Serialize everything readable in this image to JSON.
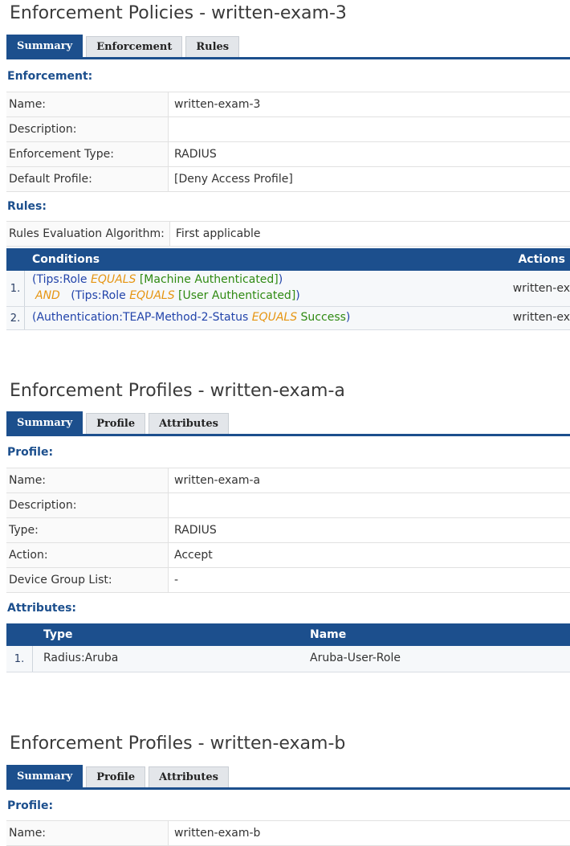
{
  "policy": {
    "title": "Enforcement Policies - written-exam-3",
    "tabs": [
      "Summary",
      "Enforcement",
      "Rules"
    ],
    "section_enforcement": "Enforcement:",
    "fields": [
      {
        "label": "Name:",
        "value": "written-exam-3"
      },
      {
        "label": "Description:",
        "value": ""
      },
      {
        "label": "Enforcement Type:",
        "value": "RADIUS"
      },
      {
        "label": "Default Profile:",
        "value": "[Deny Access Profile]"
      }
    ],
    "section_rules": "Rules:",
    "algorithm_label": "Rules Evaluation Algorithm:",
    "algorithm_value": "First applicable",
    "rules_headers": {
      "conditions": "Conditions",
      "actions": "Actions"
    },
    "rules": [
      {
        "num": "1.",
        "line1": {
          "open": "(",
          "attr": "Tips:Role",
          "op": "EQUALS",
          "val": "[Machine Authenticated]",
          "close": ")"
        },
        "line2": {
          "join": "AND",
          "open": "(",
          "attr": "Tips:Role",
          "op": "EQUALS",
          "val": "[User Authenticated]",
          "close": ")"
        },
        "action": "written-ex"
      },
      {
        "num": "2.",
        "line1": {
          "open": "(",
          "attr": "Authentication:TEAP-Method-2-Status",
          "op": "EQUALS",
          "val": "Success",
          "close": ")"
        },
        "action": "written-ex"
      }
    ]
  },
  "profile_a": {
    "title": "Enforcement Profiles - written-exam-a",
    "tabs": [
      "Summary",
      "Profile",
      "Attributes"
    ],
    "section_profile": "Profile:",
    "fields": [
      {
        "label": "Name:",
        "value": "written-exam-a"
      },
      {
        "label": "Description:",
        "value": ""
      },
      {
        "label": "Type:",
        "value": "RADIUS"
      },
      {
        "label": "Action:",
        "value": "Accept"
      },
      {
        "label": "Device Group List:",
        "value": "-"
      }
    ],
    "section_attributes": "Attributes:",
    "attr_headers": {
      "type": "Type",
      "name": "Name"
    },
    "attributes": [
      {
        "num": "1.",
        "type": "Radius:Aruba",
        "name": "Aruba-User-Role"
      }
    ]
  },
  "profile_b": {
    "title": "Enforcement Profiles - written-exam-b",
    "tabs": [
      "Summary",
      "Profile",
      "Attributes"
    ],
    "section_profile": "Profile:",
    "fields": [
      {
        "label": "Name:",
        "value": "written-exam-b"
      }
    ]
  },
  "colors": {
    "accent": "#1c4f8d",
    "attribute": "#2244aa",
    "operator": "#e69512",
    "value": "#2f8a12"
  }
}
